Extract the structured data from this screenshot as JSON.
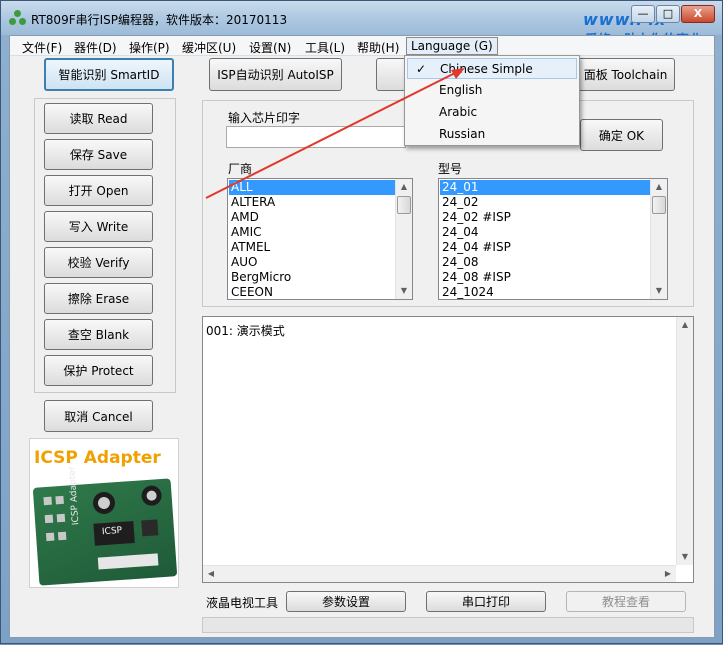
{
  "window": {
    "title": "RT809F串行ISP编程器，软件版本：20170113",
    "watermark_top": "www.Fix",
    "watermark_bottom": "爱修，助力你的事业",
    "controls": {
      "minimize": "—",
      "maximize": "□",
      "close": "X"
    }
  },
  "menu": [
    "文件(F)",
    "器件(D)",
    "操作(P)",
    "缓冲区(U)",
    "设置(N)",
    "工具(L)",
    "帮助(H)",
    "Language (G)"
  ],
  "toolbar": {
    "smartid": "智能识别 SmartID",
    "autoisp": "ISP自动识别 AutoISP",
    "toolchain": "面板 Toolchain"
  },
  "ops": [
    "读取 Read",
    "保存 Save",
    "打开 Open",
    "写入 Write",
    "校验 Verify",
    "擦除 Erase",
    "查空 Blank",
    "保护 Protect"
  ],
  "cancel": "取消 Cancel",
  "chip": {
    "input_label": "输入芯片印字",
    "input_value": "",
    "ok": "确定 OK",
    "vendor_label": "厂商",
    "model_label": "型号",
    "vendors": [
      "ALL",
      "ALTERA",
      "AMD",
      "AMIC",
      "ATMEL",
      "AUO",
      "BergMicro",
      "CEEON"
    ],
    "models": [
      "24_01",
      "24_02",
      "24_02 #ISP",
      "24_04",
      "24_04 #ISP",
      "24_08",
      "24_08 #ISP",
      "24_1024"
    ]
  },
  "log": {
    "line": "001: 演示模式"
  },
  "icsp": {
    "title": "ICSP Adapter",
    "board_text": "ICSP Adapter",
    "chip_text": "ICSP"
  },
  "statusbar": {
    "lcd_label": "液晶电视工具",
    "params": "参数设置",
    "serial": "串口打印",
    "tutorial": "教程查看"
  },
  "language_menu": {
    "check": "✓",
    "items": [
      "Chinese Simple",
      "English",
      "Arabic",
      "Russian"
    ]
  }
}
